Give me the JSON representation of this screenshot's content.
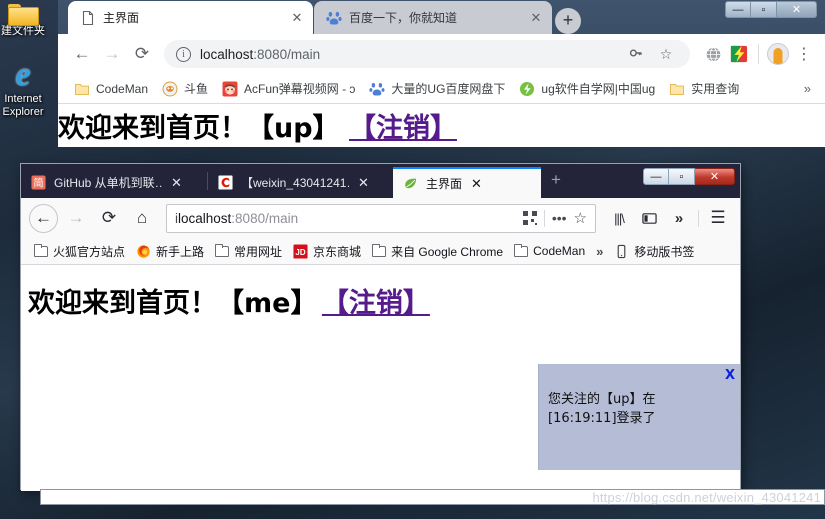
{
  "desktop": {
    "icons": [
      {
        "name": "新建文件夹",
        "display": "建文件夹",
        "icon": "folder-icon"
      },
      {
        "name": "Internet Explorer",
        "display": "Internet\nExplorer",
        "icon": "internet-explorer-icon"
      }
    ]
  },
  "chrome_window": {
    "tabs": [
      {
        "title": "主界面",
        "favicon": "page-icon",
        "active": true,
        "close": "✕"
      },
      {
        "title": "百度一下，你就知道",
        "favicon": "baidu-icon",
        "active": false,
        "close": "✕"
      }
    ],
    "new_tab_label": "+",
    "window_controls": {
      "minimize": "—",
      "maximize": "▫",
      "close": "✕"
    },
    "toolbar": {
      "back": "←",
      "forward": "→",
      "reload": "⟳",
      "info_icon": "i",
      "url_host": "localhost",
      "url_rest": ":8080/main",
      "key_icon": "⚷",
      "star_icon": "☆",
      "menu_icon": "⋮"
    },
    "bookmarks": [
      {
        "label": "CodeMan",
        "icon": "folder-icon"
      },
      {
        "label": "斗鱼",
        "icon": "douyu-icon"
      },
      {
        "label": "AcFun弹幕视频网 - ↄ",
        "icon": "acfun-icon"
      },
      {
        "label": "大量的UG百度网盘下",
        "icon": "baidu-icon"
      },
      {
        "label": "ug软件自学网|中国ug",
        "icon": "ug-icon"
      },
      {
        "label": "实用查询",
        "icon": "folder-icon"
      }
    ],
    "bookmarks_overflow": "»",
    "page": {
      "heading_text": "欢迎来到首页！【up】",
      "logout_link": "【注销】"
    }
  },
  "firefox_window": {
    "tabs": [
      {
        "title": "GitHub 从单机到联…",
        "favicon": "jianshu-icon",
        "active": false,
        "close": "✕"
      },
      {
        "title": "【weixin_43041241…",
        "favicon": "csdn-icon",
        "active": false,
        "close": "✕"
      },
      {
        "title": "主界面",
        "favicon": "leaf-icon",
        "active": true,
        "close": "✕"
      }
    ],
    "new_tab_label": "+",
    "window_controls": {
      "minimize": "—",
      "maximize": "▫",
      "close": "✕"
    },
    "toolbar": {
      "back": "←",
      "forward": "→",
      "reload": "⟳",
      "home": "⌂",
      "info_icon": "i",
      "url_host": "localhost",
      "url_rest": ":8080/main",
      "qr_icon": "qr-code-icon",
      "page_actions": "•••",
      "star_icon": "☆",
      "library_icon": "|||\\",
      "sidebar_icon": "▤",
      "overflow_icon": "»",
      "menu_icon": "☰"
    },
    "bookmarks": [
      {
        "label": "火狐官方站点",
        "icon": "folder-icon"
      },
      {
        "label": "新手上路",
        "icon": "firefox-icon"
      },
      {
        "label": "常用网址",
        "icon": "folder-icon"
      },
      {
        "label": "京东商城",
        "icon": "jd-icon"
      },
      {
        "label": "来自 Google Chrome",
        "icon": "folder-icon"
      },
      {
        "label": "CodeMan",
        "icon": "folder-icon"
      }
    ],
    "bookmarks_overflow": "»",
    "mobile_bookmarks": {
      "label": "移动版书签",
      "icon": "mobile-icon"
    },
    "page": {
      "heading_text": "欢迎来到首页！【me】",
      "logout_link": "【注销】"
    },
    "popup": {
      "close_label": "X",
      "line1": "您关注的【up】在",
      "line2": "[16:19:11]登录了"
    }
  },
  "watermark": "https://blog.csdn.net/weixin_43041241",
  "colors": {
    "chrome_tabstrip": "#3b5068",
    "firefox_tabstrip": "#23243a",
    "firefox_active_tab_accent": "#0a84ff",
    "link_purple": "#551a8b",
    "popup_bg": "#b4bcd6",
    "popup_close_blue": "#0a22e0"
  }
}
